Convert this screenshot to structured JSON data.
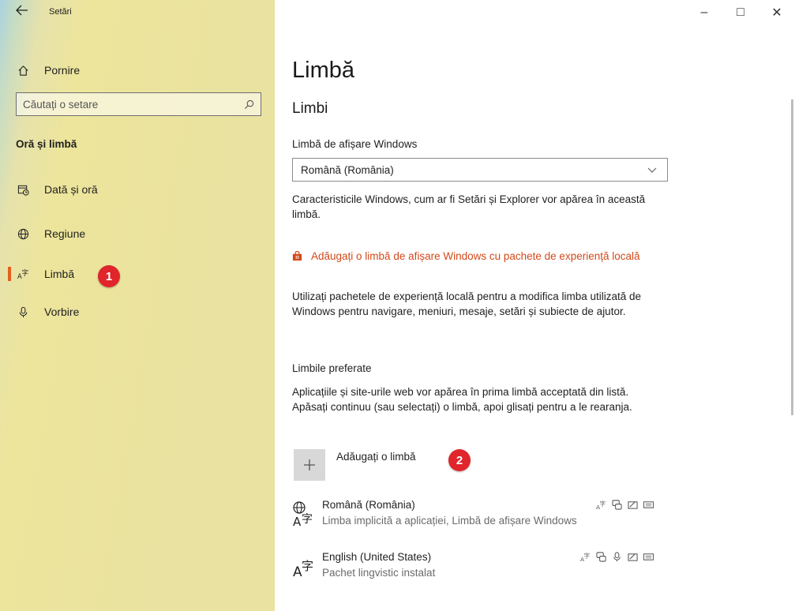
{
  "window": {
    "title": "Setări",
    "controls": {
      "minimize": "–",
      "maximize": "□",
      "close": "✕"
    }
  },
  "sidebar": {
    "home_label": "Pornire",
    "search_placeholder": "Căutați o setare",
    "section_heading": "Oră și limbă",
    "items": [
      {
        "label": "Dată și oră",
        "icon": "calendar-clock-icon"
      },
      {
        "label": "Regiune",
        "icon": "globe-icon"
      },
      {
        "label": "Limbă",
        "icon": "language-icon",
        "selected": true
      },
      {
        "label": "Vorbire",
        "icon": "microphone-icon"
      }
    ]
  },
  "annotations": {
    "badge1": "1",
    "badge2": "2"
  },
  "main": {
    "page_title": "Limbă",
    "section_title": "Limbi",
    "display_language_label": "Limbă de afișare Windows",
    "display_language_value": "Română (România)",
    "display_language_desc": "Caracteristicile Windows, cum ar fi Setări și Explorer vor apărea în această limbă.",
    "experience_link": "Adăugați o limbă de afișare Windows cu pachete de experiență locală",
    "experience_desc": "Utilizați pachetele de experiență locală pentru a modifica limba utilizată de Windows pentru navigare, meniuri, mesaje, setări și subiecte de ajutor.",
    "preferred_label": "Limbile preferate",
    "preferred_desc": "Aplicațiile și site-urile web vor apărea în prima limbă acceptată din listă. Apăsați continuu (sau selectați) o limbă, apoi glisați pentru a le rearanja.",
    "add_language_label": "Adăugați o limbă",
    "languages": [
      {
        "name": "Română (România)",
        "sub": "Limba implicită a aplicației, Limbă de afișare Windows"
      },
      {
        "name": "English (United States)",
        "sub": "Pachet lingvistic instalat"
      }
    ]
  },
  "colors": {
    "accent": "#e2601f",
    "link": "#d2491a",
    "badge": "#e0252b"
  }
}
